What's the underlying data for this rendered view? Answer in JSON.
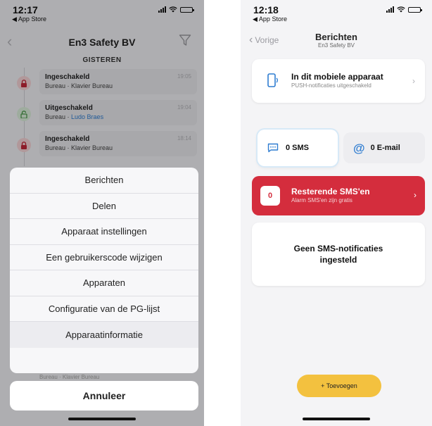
{
  "left": {
    "status": {
      "time": "12:17",
      "back_app": "◀ App Store"
    },
    "nav": {
      "title": "En3 Safety BV"
    },
    "section_header": "GISTEREN",
    "events": [
      {
        "title": "Ingeschakeld",
        "location": "Bureau",
        "separator": " · ",
        "detail": "Klavier Bureau",
        "time": "19:05",
        "state": "locked"
      },
      {
        "title": "Uitgeschakeld",
        "location": "Bureau",
        "separator": " · ",
        "detail": "Ludo Braes",
        "time": "19:04",
        "state": "unlocked"
      },
      {
        "title": "Ingeschakeld",
        "location": "Bureau",
        "separator": " · ",
        "detail": "Klavier Bureau",
        "time": "18:14",
        "state": "locked"
      }
    ],
    "peek_row": "Bureau · Klavier Bureau",
    "action_sheet": {
      "items": [
        "Berichten",
        "Delen",
        "Apparaat instellingen",
        "Een gebruikerscode wijzigen",
        "Apparaten",
        "Configuratie van de PG-lijst",
        "Apparaatinformatie"
      ],
      "cancel": "Annuleer"
    }
  },
  "right": {
    "status": {
      "time": "12:18",
      "back_app": "◀ App Store"
    },
    "nav": {
      "back": "Vorige",
      "title": "Berichten",
      "subtitle": "En3 Safety BV"
    },
    "device": {
      "title": "In dit mobiele apparaat",
      "subtitle": "PUSH-notificaties uitgeschakeld"
    },
    "tabs": {
      "sms": "0 SMS",
      "email": "0 E-mail"
    },
    "remaining": {
      "count": "0",
      "title": "Resterende SMS'en",
      "subtitle": "Alarm SMS'en zijn gratis"
    },
    "empty_message": "Geen SMS-notificaties ingesteld",
    "add_button": "+ Toevoegen"
  },
  "colors": {
    "alarm_red": "#d42d3d",
    "accent_blue": "#2f7dd1",
    "add_yellow": "#f3c13f"
  }
}
